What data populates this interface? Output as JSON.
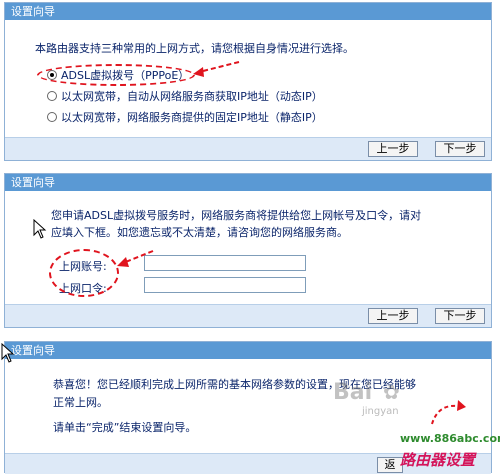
{
  "panel1": {
    "title": "设置向导",
    "intro": "本路由器支持三种常用的上网方式，请您根据自身情况进行选择。",
    "options": [
      {
        "label": "ADSL虚拟拨号（PPPoE）",
        "checked": true
      },
      {
        "label": "以太网宽带，自动从网络服务商获取IP地址（动态IP）",
        "checked": false
      },
      {
        "label": "以太网宽带，网络服务商提供的固定IP地址（静态IP）",
        "checked": false
      }
    ],
    "prev_label": "上一步",
    "next_label": "下一步"
  },
  "panel2": {
    "title": "设置向导",
    "desc_line1": "您申请ADSL虚拟拨号服务时，网络服务商将提供给您上网帐号及口令，请对",
    "desc_line2": "应填入下框。如您遗忘或不太清楚，请咨询您的网络服务商。",
    "account_label": "上网账号:",
    "password_label": "上网口令:",
    "account_value": "",
    "password_value": "",
    "prev_label": "上一步",
    "next_label": "下一步"
  },
  "panel3": {
    "title": "设置向导",
    "congrats_line1": "恭喜您！您已经顺利完成上网所需的基本网络参数的设置，现在您已经能够",
    "congrats_line2": "正常上网。",
    "finish_hint": "请单击“完成”结束设置向导。",
    "finish_label": "返"
  },
  "watermark": {
    "url": "www.886abc.com",
    "brand": "路由器设置",
    "baidu": "Bai",
    "jingyan": "jingyan"
  },
  "colors": {
    "titlebar": "#5a99d4",
    "accent_red": "#e0141e",
    "text": "#0a246a"
  }
}
